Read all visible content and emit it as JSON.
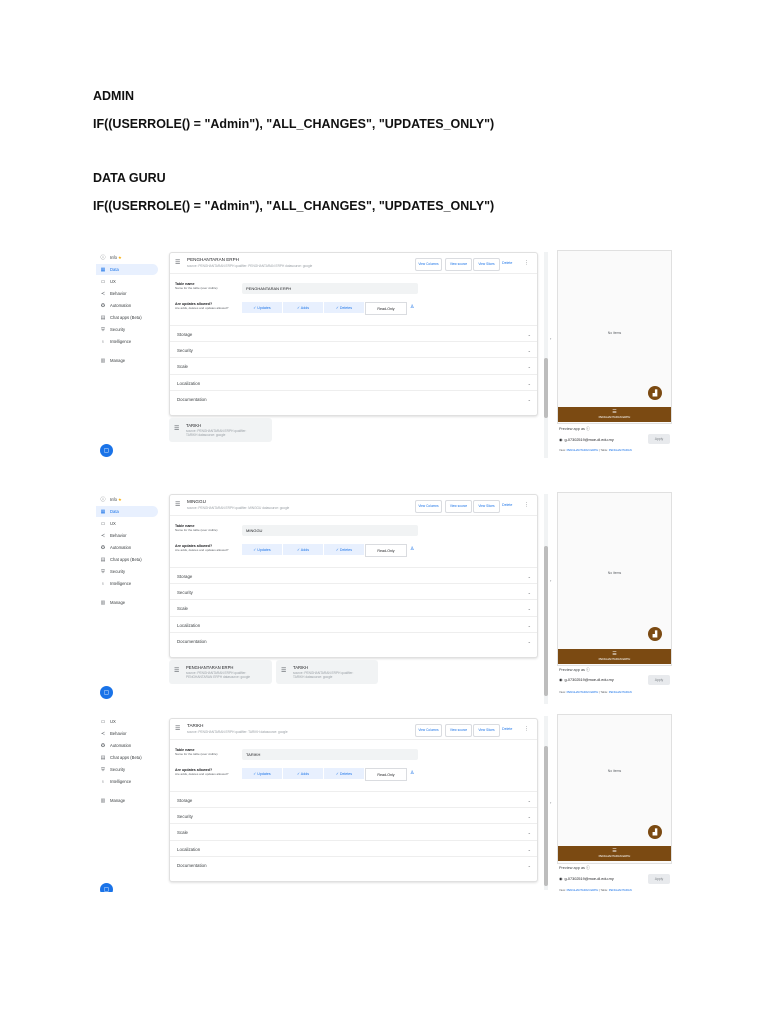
{
  "doc": {
    "heading_admin": "ADMIN",
    "formula_admin": "IF((USERROLE() = \"Admin\"), \"ALL_CHANGES\", \"UPDATES_ONLY\")",
    "heading_guru": "DATA GURU",
    "formula_guru": "IF((USERROLE() = \"Admin\"), \"ALL_CHANGES\", \"UPDATES_ONLY\")"
  },
  "common": {
    "nav": {
      "info": "Info",
      "data": "Data",
      "ux": "UX",
      "behavior": "Behavior",
      "automation": "Automation",
      "chat_apps": "Chat apps (Beta)",
      "security": "Security",
      "intelligence": "Intelligence",
      "manage": "Manage"
    },
    "btn_view_columns": "View Columns",
    "btn_view_source": "View source",
    "btn_view_slices": "View Slices",
    "btn_delete": "Delete",
    "table_name_label": "Table name",
    "table_name_help": "Name for the table (user visible)",
    "updates_label": "Are updates allowed?",
    "updates_help": "Are adds, deletes and updates allowed?",
    "opt_updates": "✓ Updates",
    "opt_adds": "✓ Adds",
    "opt_deletes": "✓ Deletes",
    "opt_readonly": "Read-Only",
    "sections": [
      "Storage",
      "Security",
      "Scale",
      "Localization",
      "Documentation"
    ],
    "no_items": "No items",
    "bottom_nav_label": "PENGHANTARAN ERPH",
    "preview_as": "Preview app as ⓘ",
    "preview_user": "g-07302519@moe-dl.edu.my",
    "apply": "Apply",
    "view_prefix": "View:",
    "view_value": "PENGHANTARAN ERPH",
    "table_prefix": "Table:",
    "table_value": "PENGHANTARAN"
  },
  "shots": [
    {
      "table_name": "PENGHANTARAN ERPH",
      "source_line": "source: PENGHANTARAN ERPH   qualifier: PENGHANTARAN ERPH   datasource: google",
      "input_value": "PENGHANTARAN ERPH",
      "cards": [
        {
          "name": "TARIKH",
          "line1": "source: PENGHANTARAN ERPH   qualifier:",
          "line2": "TARIKH   datasource: google"
        }
      ]
    },
    {
      "table_name": "MINGGU",
      "source_line": "source: PENGHANTARAN ERPH   qualifier: MINGGU   datasource: google",
      "input_value": "MINGGU",
      "cards": [
        {
          "name": "PENGHANTARAN ERPH",
          "line1": "source: PENGHANTARAN ERPH   qualifier:",
          "line2": "PENGHANTARAN ERPH   datasource: google"
        },
        {
          "name": "TARIKH",
          "line1": "source: PENGHANTARAN ERPH   qualifier:",
          "line2": "TARIKH   datasource: google"
        }
      ]
    },
    {
      "table_name": "TARIKH",
      "source_line": "source: PENGHANTARAN ERPH   qualifier: TARIKH   datasource: google",
      "input_value": "TARIKH",
      "cards": []
    }
  ]
}
